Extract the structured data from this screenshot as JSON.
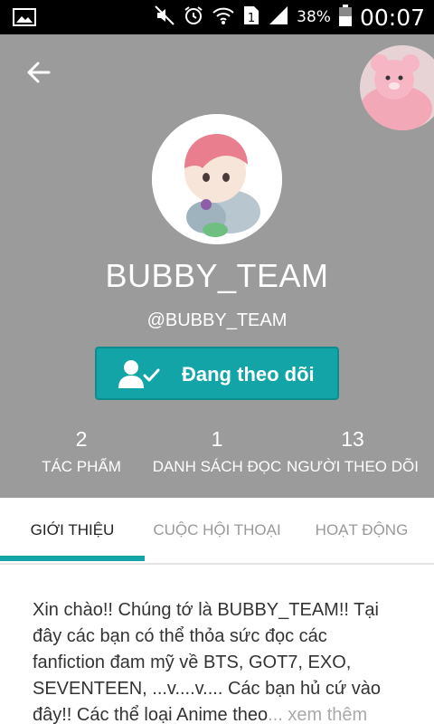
{
  "status_bar": {
    "battery": "38%",
    "time": "00:07",
    "icons": [
      "image-icon",
      "mute-icon",
      "alarm-icon",
      "wifi-icon",
      "sim-icon",
      "signal-icon",
      "battery-icon"
    ]
  },
  "profile": {
    "username": "BUBBY_TEAM",
    "handle": "@BUBBY_TEAM",
    "follow_label": "Đang theo dõi"
  },
  "stats": [
    {
      "value": "2",
      "label": "TÁC PHẨM"
    },
    {
      "value": "1",
      "label": "DANH SÁCH ĐỌC"
    },
    {
      "value": "13",
      "label": "NGƯỜI THEO DÕI"
    }
  ],
  "tabs": [
    {
      "label": "GIỚI THIỆU",
      "active": true
    },
    {
      "label": "CUỘC HỘI THOẠI",
      "active": false
    },
    {
      "label": "HOẠT ĐỘNG",
      "active": false
    }
  ],
  "about": {
    "text": "Xin chào!! Chúng tớ là BUBBY_TEAM!! Tại đây các bạn có thể thỏa sức đọc các fanfiction đam mỹ về BTS, GOT7, EXO, SEVENTEEN, ...v....v.... Các bạn hủ cứ vào đây!! Các thể loại Anime theo",
    "more_label": "... xem thêm"
  },
  "colors": {
    "header_bg": "#9b9b9b",
    "accent": "#12a4a6"
  }
}
